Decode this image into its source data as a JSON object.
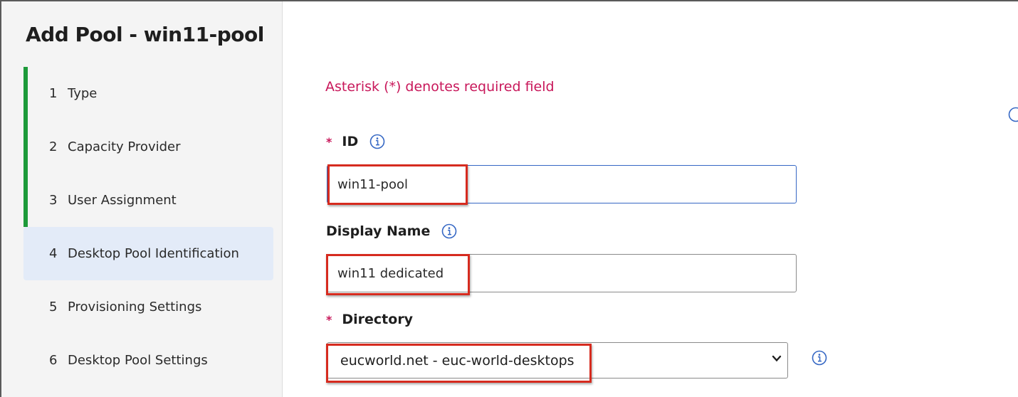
{
  "wizard": {
    "title": "Add Pool - win11-pool",
    "steps": [
      {
        "number": "1",
        "label": "Type",
        "state": "done"
      },
      {
        "number": "2",
        "label": "Capacity Provider",
        "state": "done"
      },
      {
        "number": "3",
        "label": "User Assignment",
        "state": "done"
      },
      {
        "number": "4",
        "label": "Desktop Pool Identification",
        "state": "active"
      },
      {
        "number": "5",
        "label": "Provisioning Settings",
        "state": "pending"
      },
      {
        "number": "6",
        "label": "Desktop Pool Settings",
        "state": "pending"
      }
    ]
  },
  "form": {
    "required_note": "Asterisk (*) denotes required field",
    "id_field": {
      "asterisk": "*",
      "label": "ID",
      "value": "win11-pool"
    },
    "display_name_field": {
      "label": "Display Name",
      "value": "win11 dedicated"
    },
    "directory_field": {
      "asterisk": "*",
      "label": "Directory",
      "selected": "eucworld.net - euc-world-desktops"
    }
  },
  "colors": {
    "accent_done": "#1d9a3a",
    "active_step_bg": "#e3ebf8",
    "required": "#c8175a",
    "info_icon": "#3567c4",
    "highlight_box": "#d62b1f"
  },
  "icons": [
    "info-icon",
    "chevron-down-icon"
  ]
}
